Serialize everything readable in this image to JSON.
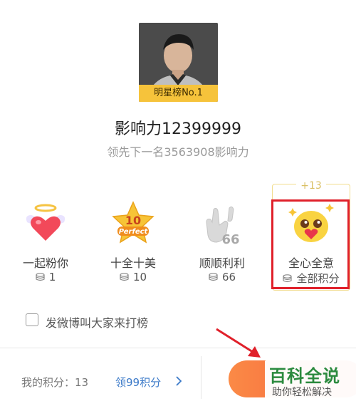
{
  "star": {
    "rank_badge": "明星榜No.1",
    "influence": "影响力12399999",
    "lead": "领先下一名3563908影响力"
  },
  "gifts": [
    {
      "label": "一起粉你",
      "price": "1",
      "icon": "winged-heart-icon"
    },
    {
      "label": "十全十美",
      "price": "10",
      "icon": "perfect-10-star-icon",
      "icon_text_top": "10",
      "icon_text_bottom": "Perfect"
    },
    {
      "label": "顺顺利利",
      "price": "66",
      "icon": "hand-66-icon",
      "icon_text": "66"
    },
    {
      "label": "全心全意",
      "price": "全部积分",
      "icon": "heart-eyes-emoji-icon",
      "selected": true,
      "plus_count": "+13"
    }
  ],
  "weibo": {
    "checked": false,
    "label": "发微博叫大家来打榜"
  },
  "footer": {
    "my_points": "我的积分：13",
    "claim_link": "领99积分"
  },
  "watermark": {
    "title": "百科全说",
    "subtitle": "助你轻松解决"
  },
  "colors": {
    "badge_yellow": "#f6c33b",
    "link_blue": "#3a79c8",
    "highlight_red": "#e0202a",
    "send_button_orange": "#f45b3a",
    "selected_border_gold": "#f1dc8d"
  }
}
